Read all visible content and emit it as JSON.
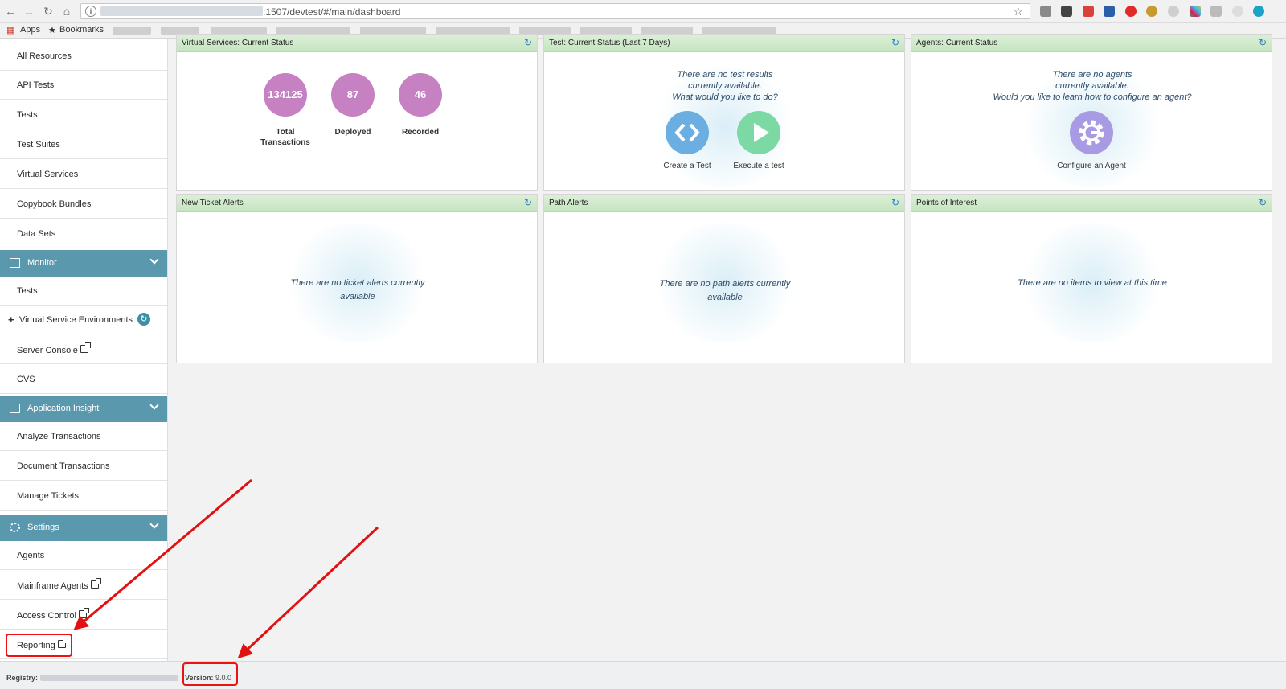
{
  "browser": {
    "url_path": ":1507/devtest/#/main/dashboard",
    "bookmarks": {
      "apps_label": "Apps",
      "bookmarks_label": "Bookmarks"
    }
  },
  "sidebar": {
    "top_items": [
      {
        "label": "All Resources"
      },
      {
        "label": "API Tests"
      },
      {
        "label": "Tests"
      },
      {
        "label": "Test Suites"
      },
      {
        "label": "Virtual Services"
      },
      {
        "label": "Copybook Bundles"
      },
      {
        "label": "Data Sets"
      }
    ],
    "monitor": {
      "title": "Monitor",
      "items": [
        {
          "label": "Tests"
        },
        {
          "label": "Virtual Service Environments"
        },
        {
          "label": "Server Console"
        },
        {
          "label": "CVS"
        }
      ]
    },
    "app_insight": {
      "title": "Application Insight",
      "items": [
        {
          "label": "Analyze Transactions"
        },
        {
          "label": "Document Transactions"
        },
        {
          "label": "Manage Tickets"
        }
      ]
    },
    "settings": {
      "title": "Settings",
      "items": [
        {
          "label": "Agents"
        },
        {
          "label": "Mainframe Agents"
        },
        {
          "label": "Access Control"
        },
        {
          "label": "Reporting"
        }
      ]
    }
  },
  "widgets": {
    "virtual_services": {
      "title": "Virtual Services: Current Status",
      "stats": [
        {
          "value": "134125",
          "label_line1": "Total",
          "label_line2": "Transactions"
        },
        {
          "value": "87",
          "label_line1": "Deployed",
          "label_line2": ""
        },
        {
          "value": "46",
          "label_line1": "Recorded",
          "label_line2": ""
        }
      ]
    },
    "test_status": {
      "title": "Test: Current Status (Last 7 Days)",
      "msg_line1": "There are no test results",
      "msg_line2": "currently available.",
      "msg_line3": "What would you like to do?",
      "create_label": "Create a Test",
      "execute_label": "Execute a test"
    },
    "agents": {
      "title": "Agents: Current Status",
      "msg_line1": "There are no agents",
      "msg_line2": "currently available.",
      "msg_line3": "Would you like to learn how to configure an agent?",
      "configure_label": "Configure an Agent"
    },
    "ticket_alerts": {
      "title": "New Ticket Alerts",
      "msg_line1": "There are no ticket alerts currently",
      "msg_line2": "available"
    },
    "path_alerts": {
      "title": "Path Alerts",
      "msg_line1": "There are no path alerts currently",
      "msg_line2": "available"
    },
    "points_of_interest": {
      "title": "Points of Interest",
      "msg": "There are no items to view at this time"
    }
  },
  "footer": {
    "registry_label": "Registry:",
    "version_label": "Version:",
    "version_value": "9.0.0"
  },
  "colors": {
    "sidebar_section": "#5a98ad",
    "bubble": "#c681c3",
    "create_test": "#6aaee2",
    "execute_test": "#7dd9a4",
    "configure_agent": "#a89be3",
    "annotation": "#e11111"
  }
}
